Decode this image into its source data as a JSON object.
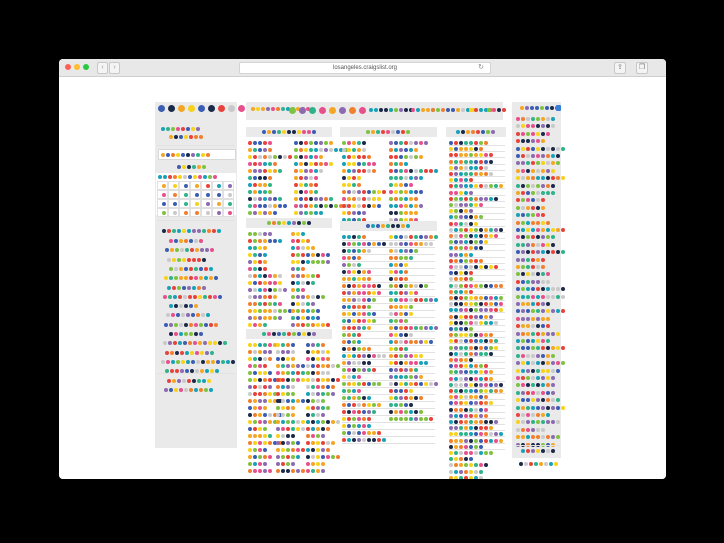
{
  "browser": {
    "url": "losangeles.craigslist.org",
    "traffic_lights": [
      "#ff5f57",
      "#febc2e",
      "#28c840"
    ],
    "back_icon": "chevron-left-icon",
    "forward_icon": "chevron-right-icon",
    "reload_icon": "reload-icon",
    "share_icon": "share-icon",
    "tabs_icon": "tabs-icon"
  },
  "page": {
    "note": "",
    "palette": [
      "#e8433a",
      "#f5a623",
      "#f7d21b",
      "#2eb38a",
      "#17a2b8",
      "#3b5db3",
      "#1b2a4a",
      "#e8508c",
      "#8c6bb1",
      "#7fc241",
      "#c9c9c9",
      "#f07f2e"
    ]
  }
}
